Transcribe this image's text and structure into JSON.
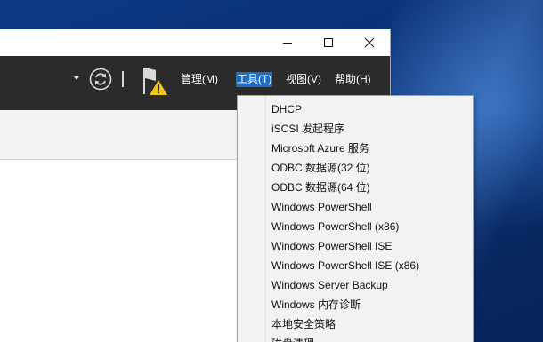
{
  "window": {
    "menu": {
      "manage": "管理(M)",
      "tools": "工具(T)",
      "view": "视图(V)",
      "help": "帮助(H)"
    }
  },
  "tools_menu": {
    "items": [
      "DHCP",
      "iSCSI 发起程序",
      "Microsoft Azure 服务",
      "ODBC 数据源(32 位)",
      "ODBC 数据源(64 位)",
      "Windows PowerShell",
      "Windows PowerShell (x86)",
      "Windows PowerShell ISE",
      "Windows PowerShell ISE (x86)",
      "Windows Server Backup",
      "Windows 内存诊断",
      "本地安全策略",
      "磁盘清理"
    ]
  },
  "colors": {
    "menubar": "#2b2b2b",
    "menu_highlight": "#1e6fc4",
    "dropdown_bg": "#f2f2f2",
    "warning": "#f5c518"
  }
}
